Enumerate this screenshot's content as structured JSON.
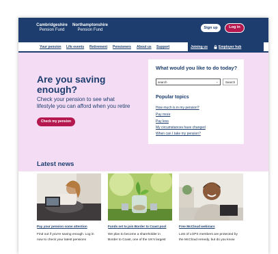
{
  "header": {
    "brand_cambs": "Cambridgeshire",
    "brand_cambs_sub": "Pension Fund",
    "brand_northants": "Northamptonshire",
    "brand_northants_sub": "Pension Fund",
    "signup_label": "Sign up",
    "login_label": "Log in"
  },
  "nav": {
    "items": [
      "Your pension",
      "Life events",
      "Retirement",
      "Pensioners",
      "About us",
      "Support"
    ],
    "joining": "Joining us",
    "employer": "Employer hub"
  },
  "hero": {
    "title": "Are you saving enough?",
    "subtitle": "Check your pension to see what lifestyle you can afford when you retire",
    "cta_label": "Check my pension"
  },
  "search_card": {
    "title": "What would you like to do today?",
    "input_value": "search",
    "search_button": "Search",
    "topics_title": "Popular topics",
    "topics": [
      "How much is in my pension?",
      "Pay more",
      "Pay less",
      "My circumstances have changed",
      "When can I take my pension?"
    ]
  },
  "news": {
    "title": "Latest news",
    "items": [
      {
        "link": "Pay your pension some attention",
        "line1": "Find out if you're saving enough. Log in",
        "line2": "now to check your latest pensions"
      },
      {
        "link": "Funds set to join Border to Coast pool",
        "line1": "We plan to become a shareholder in",
        "line2": "Border to Coast, one of the UK's largest"
      },
      {
        "link": "Free McCloud webinars",
        "line1": "Lots of LGPS members are protected by",
        "line2": "the McCloud remedy, but do you know"
      }
    ]
  },
  "colors": {
    "navy": "#1c3d6e",
    "brand_pink": "#b5174f",
    "hero_bg": "#f4dcf5"
  }
}
